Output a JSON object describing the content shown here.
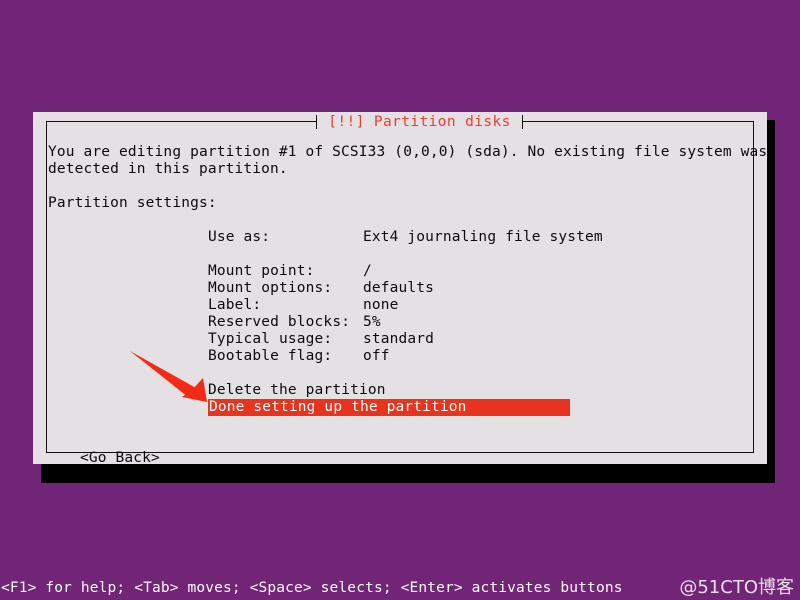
{
  "screen": {
    "background_color": "#722577",
    "text_color": "#ffffff"
  },
  "dialog": {
    "title": "[!!] Partition disks",
    "title_color": "#e8402a",
    "background_color": "#e4e0e4",
    "border_color": "#101010",
    "intro_line_1": "You are editing partition #1 of SCSI33 (0,0,0) (sda). No existing file system was",
    "intro_line_2": "detected in this partition.",
    "settings_heading": "Partition settings:",
    "settings": [
      {
        "label": "Use as:",
        "value": "Ext4 journaling file system"
      },
      {
        "label": "Mount point:",
        "value": "/"
      },
      {
        "label": "Mount options:",
        "value": "defaults"
      },
      {
        "label": "Label:",
        "value": "none"
      },
      {
        "label": "Reserved blocks:",
        "value": "5%"
      },
      {
        "label": "Typical usage:",
        "value": "standard"
      },
      {
        "label": "Bootable flag:",
        "value": "off"
      }
    ],
    "actions": [
      {
        "label": "Delete the partition",
        "selected": false
      },
      {
        "label": "Done setting up the partition",
        "selected": true
      }
    ],
    "selection_bg_color": "#e8331f",
    "selection_fg_color": "#ffffff",
    "go_back_button": "<Go Back>"
  },
  "annotation": {
    "arrow_color": "#f22a16",
    "points_to": "Done setting up the partition"
  },
  "statusbar": {
    "help_text": "<F1> for help; <Tab> moves; <Space> selects; <Enter> activates buttons",
    "watermark": "@51CTO博客"
  }
}
